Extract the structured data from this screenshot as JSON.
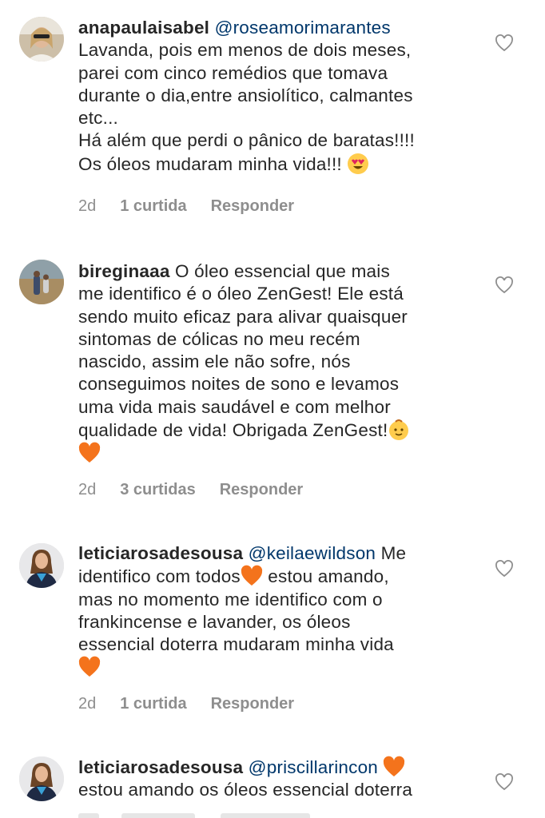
{
  "comments": [
    {
      "username": "anapaulaisabel",
      "mention": "@roseamorimarantes",
      "text": "Lavanda, pois em menos de dois meses,\nparei com cinco remédios que tomava\ndurante o dia,entre ansiolítico, calmantes\netc...\nHá além que perdi o pânico de baratas!!!!\nOs óleos mudaram minha vida!!! ",
      "emoji": "heart-eyes-emoji",
      "time": "2d",
      "likes": "1 curtida",
      "reply": "Responder"
    },
    {
      "username": "bireginaaa",
      "mention": "",
      "text": "O óleo essencial que mais\nme identifico é o óleo ZenGest! Ele está\nsendo muito eficaz para alivar quaisquer\nsintomas de cólicas no meu recém\nnascido, assim ele não sofre, nós\nconseguimos noites de sono e levamos\numa vida mais saudável e com melhor\nqualidade de vida! Obrigada ZenGest!",
      "emoji": "baby-emoji",
      "time": "2d",
      "likes": "3 curtidas",
      "reply": "Responder"
    },
    {
      "username": "leticiarosadesousa",
      "mention": "@keilaewildson",
      "text_a": " Me\nidentifico com todos",
      "text_b": " estou amando,\nmas no momento me identifico com o\nfrankincense e lavander, os óleos\nessencial doterra mudaram minha vida\n",
      "time": "2d",
      "likes": "1 curtida",
      "reply": "Responder"
    },
    {
      "username": "leticiarosadesousa",
      "mention": "@priscillarincon",
      "text": "\nestou amando os óleos essencial doterra"
    }
  ],
  "colors": {
    "text": "#262626",
    "mention": "#00376b",
    "meta": "#8e8e8e",
    "orange_heart": "#f4731c"
  }
}
